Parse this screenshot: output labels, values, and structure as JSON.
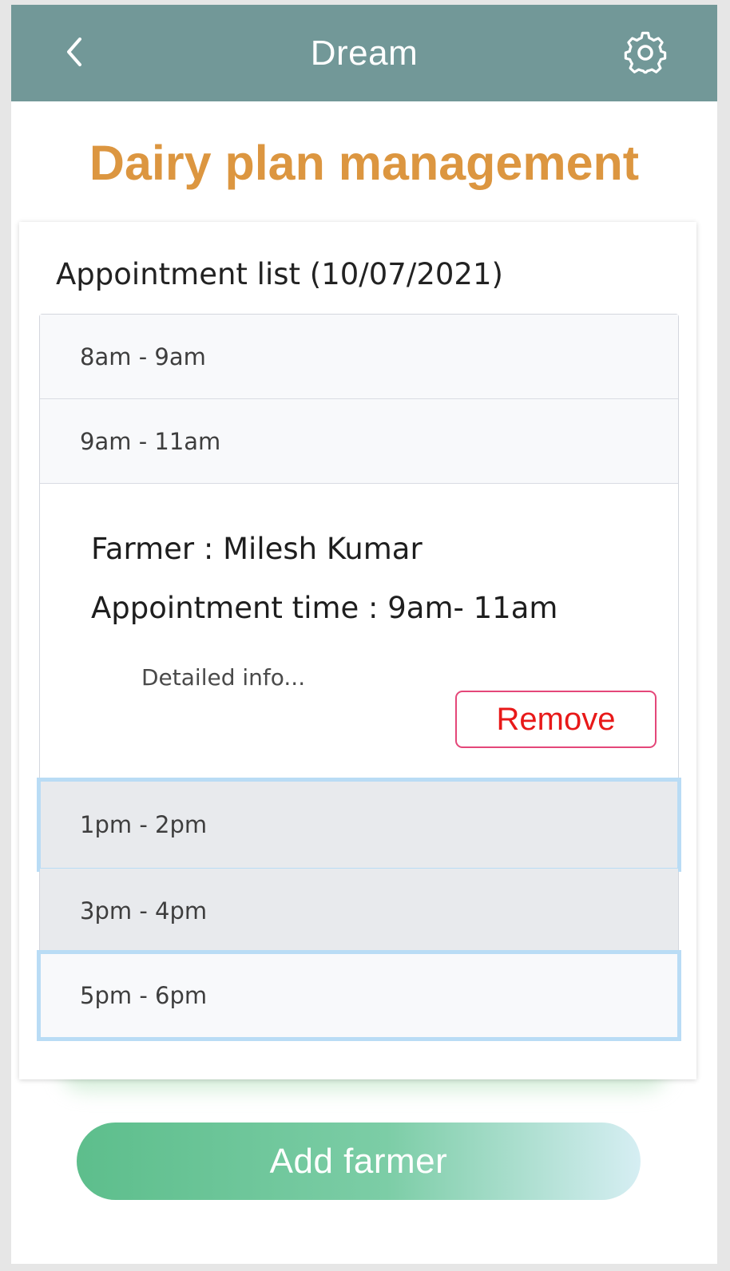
{
  "header": {
    "title": "Dream",
    "back_icon": "chevron-left-icon",
    "settings_icon": "gear-icon"
  },
  "page": {
    "title": "Dairy plan management"
  },
  "appointments": {
    "title": "Appointment list (10/07/2021)",
    "slots": [
      {
        "label": "8am - 9am"
      },
      {
        "label": "9am - 11am"
      },
      {
        "label": "1pm - 2pm"
      },
      {
        "label": "3pm - 4pm"
      },
      {
        "label": "5pm - 6pm"
      }
    ],
    "details": {
      "farmer_line": "Farmer : Milesh Kumar",
      "time_line": "Appointment time :  9am- 11am",
      "detail_link": "Detailed info...",
      "remove_label": "Remove"
    }
  },
  "footer": {
    "add_label": "Add farmer"
  },
  "colors": {
    "header_bg": "#729898",
    "title_color": "#dc9640",
    "remove_border": "#e44779",
    "remove_text": "#e81919",
    "add_gradient_start": "#5dbe8c",
    "selection_outline": "#b9dcf5"
  }
}
